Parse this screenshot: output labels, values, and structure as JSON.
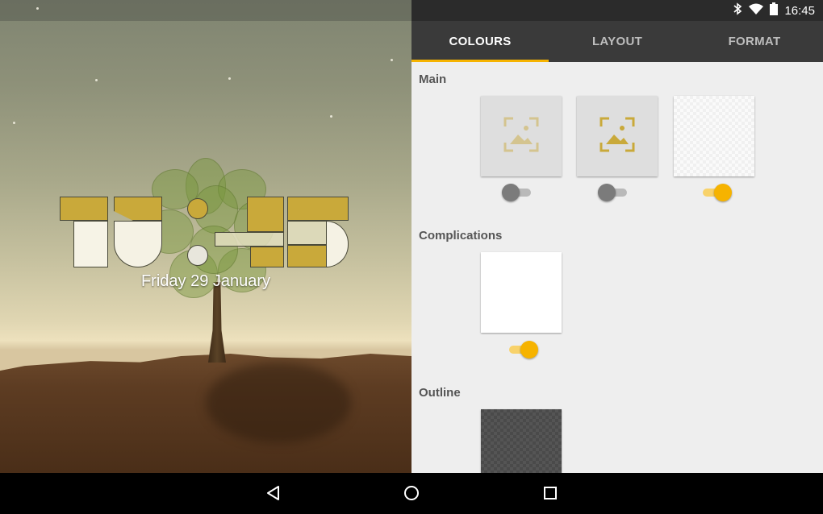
{
  "preview": {
    "date": "Friday 29 January"
  },
  "status_bar": {
    "time": "16:45",
    "icons": [
      "bluetooth-icon",
      "wifi-icon",
      "battery-icon"
    ]
  },
  "tabs": [
    {
      "label": "COLOURS",
      "active": true
    },
    {
      "label": "LAYOUT",
      "active": false
    },
    {
      "label": "FORMAT",
      "active": false
    }
  ],
  "sections": {
    "main": {
      "title": "Main",
      "options": [
        {
          "type": "image-placeholder",
          "enabled": false
        },
        {
          "type": "image-placeholder",
          "enabled": false
        },
        {
          "type": "transparent",
          "enabled": true
        }
      ]
    },
    "complications": {
      "title": "Complications",
      "options": [
        {
          "type": "white",
          "enabled": true
        }
      ]
    },
    "outline": {
      "title": "Outline",
      "options": [
        {
          "type": "dark"
        }
      ]
    }
  },
  "colors": {
    "accent": "#f6b300",
    "clock_gold": "#c9a93a",
    "tab_bar": "#3a3a3a",
    "panel_bg": "#eeeeee"
  },
  "nav": [
    "back-icon",
    "home-icon",
    "recents-icon"
  ]
}
